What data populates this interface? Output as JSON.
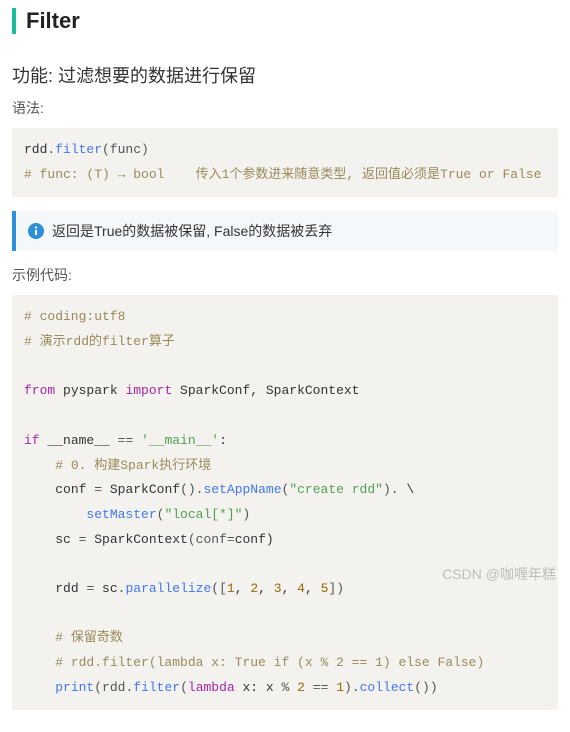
{
  "title": "Filter",
  "subhead": "功能: 过滤想要的数据进行保留",
  "syntaxLabel": "语法:",
  "syntax": {
    "line1": {
      "a": "rdd",
      "b": ".",
      "c": "filter",
      "d": "(func)"
    },
    "comment": "# func: (T) → bool    传入1个参数进来随意类型, 返回值必须是True or False"
  },
  "info": "返回是True的数据被保留, False的数据被丢弃",
  "exampleLabel": "示例代码:",
  "code": {
    "c1": "# coding:utf8",
    "c2": "# 演示rdd的filter算子",
    "imp": {
      "a": "from",
      "b": " pyspark ",
      "c": "import",
      "d": " SparkConf, SparkContext"
    },
    "ifline": {
      "a": "if",
      "b": " __name__ ",
      "c": "==",
      "d": " ",
      "e": "'__main__'",
      "f": ":"
    },
    "c3": "# 0. 构建Spark执行环境",
    "conf": {
      "a": "conf ",
      "b": "=",
      "c": " SparkConf",
      "d": "()",
      "e": ".",
      "f": "setAppName",
      "g": "(",
      "h": "\"create rdd\"",
      "i": ")",
      "j": ".",
      "k": " \\"
    },
    "master": {
      "a": "setMaster",
      "b": "(",
      "c": "\"local[*]\"",
      "d": ")"
    },
    "sc": {
      "a": "sc ",
      "b": "=",
      "c": " SparkContext",
      "d": "(conf",
      "e": "=",
      "f": "conf)"
    },
    "rdd": {
      "a": "rdd ",
      "b": "=",
      "c": " sc",
      "d": ".",
      "e": "parallelize",
      "f": "([",
      "g": "1",
      "h": ", ",
      "i": "2",
      "j": ", ",
      "k": "3",
      "l": ", ",
      "m": "4",
      "n": ", ",
      "o": "5",
      "p": "])"
    },
    "c4": "# 保留奇数",
    "c5": "# rdd.filter(lambda x: True if (x % 2 == 1) else False)",
    "print": {
      "a": "print",
      "b": "(rdd",
      "c": ".",
      "d": "filter",
      "e": "(",
      "f": "lambda",
      "g": " x: x ",
      "h": "%",
      "i": " ",
      "j": "2",
      "k": " ",
      "l": "==",
      "m": " ",
      "n": "1",
      "o": ")",
      "p": ".",
      "q": "collect",
      "r": "())"
    }
  },
  "watermark": "CSDN @咖喱年糕"
}
